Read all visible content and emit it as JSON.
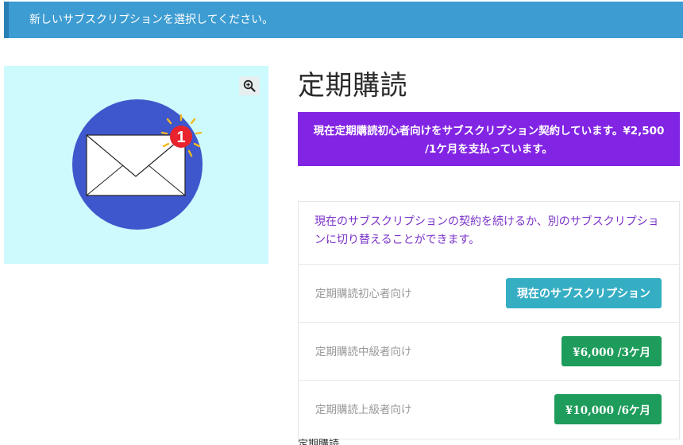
{
  "notice": {
    "text": "新しいサブスクリプションを選択してください。"
  },
  "product": {
    "title": "定期購読",
    "notification_count": "1"
  },
  "banner": {
    "text": "現在定期購読初心者向けをサブスクリプション契約しています。¥2,500 /1ケ月を支払っています。"
  },
  "switch": {
    "intro": "現在のサブスクリプションの契約を続けるか、別のサブスクリプションに切り替えることができます。",
    "plans": [
      {
        "name": "定期購読初心者向け",
        "button": "現在のサブスクリプション"
      },
      {
        "name": "定期購読中級者向け",
        "button": "¥6,000 /3ケ月"
      },
      {
        "name": "定期購読上級者向け",
        "button": "¥10,000 /6ケ月"
      }
    ]
  },
  "footer": {
    "text": "定期購読"
  },
  "colors": {
    "notice_bg": "#3d9cd2",
    "banner_bg": "#8224e3",
    "current_button": "#35aec4",
    "buy_button": "#1e9c5b",
    "image_bg": "#ccfafd"
  }
}
